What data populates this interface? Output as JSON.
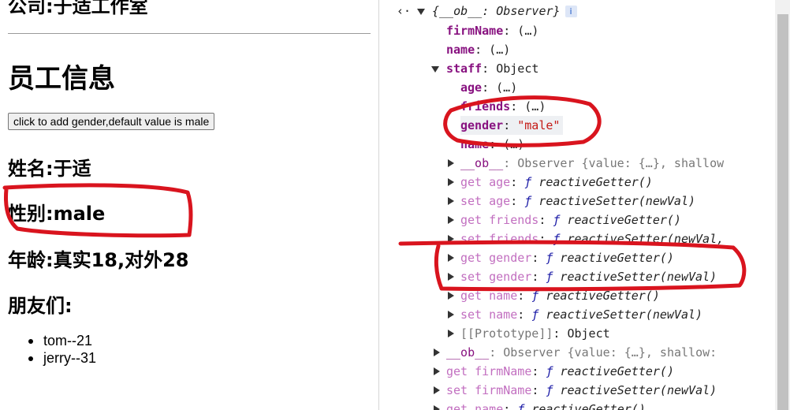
{
  "page": {
    "company": "公司:于适工作室",
    "title": "员工信息",
    "add_button": "click to add gender,default value is male",
    "name_line": "姓名:于适",
    "gender_line": "性别:male",
    "age_line": "年龄:真实18,对外28",
    "friends_heading": "朋友们:",
    "friends": [
      "tom--21",
      "jerry--31"
    ]
  },
  "devtools": {
    "back_arrow": "‹·",
    "root": {
      "text": "{__ob__: Observer}",
      "badge": "i"
    },
    "rows": [
      {
        "key": "firmName",
        "rest": ": (…)"
      },
      {
        "key": "name",
        "rest": ": (…)"
      },
      {
        "key": "staff",
        "rest": ": Object"
      },
      {
        "key": "age",
        "rest": ": (…)"
      },
      {
        "key": "friends",
        "rest": ": (…)"
      },
      {
        "key": "gender",
        "rest": ": ",
        "value": "\"male\""
      },
      {
        "key": "name",
        "rest": ": (…)"
      },
      {
        "key": "__ob__",
        "rest": ": Observer {value: {…}, shallow"
      },
      {
        "key": "get age",
        "rest": ": ",
        "fn": "ƒ",
        "call": " reactiveGetter()"
      },
      {
        "key": "set age",
        "rest": ": ",
        "fn": "ƒ",
        "call": " reactiveSetter(newVal)"
      },
      {
        "key": "get friends",
        "rest": ": ",
        "fn": "ƒ",
        "call": " reactiveGetter()"
      },
      {
        "key": "set friends",
        "rest": ": ",
        "fn": "ƒ",
        "call": " reactiveSetter(newVal,"
      },
      {
        "key": "get gender",
        "rest": ": ",
        "fn": "ƒ",
        "call": " reactiveGetter()"
      },
      {
        "key": "set gender",
        "rest": ": ",
        "fn": "ƒ",
        "call": " reactiveSetter(newVal)"
      },
      {
        "key": "get name",
        "rest": ": ",
        "fn": "ƒ",
        "call": " reactiveGetter()"
      },
      {
        "key": "set name",
        "rest": ": ",
        "fn": "ƒ",
        "call": " reactiveSetter(newVal)"
      },
      {
        "key": "[[Prototype]]",
        "rest": ": Object"
      },
      {
        "key": "__ob__",
        "rest": ": Observer {value: {…}, shallow:"
      },
      {
        "key": "get firmName",
        "rest": ": ",
        "fn": "ƒ",
        "call": " reactiveGetter()"
      },
      {
        "key": "set firmName",
        "rest": ": ",
        "fn": "ƒ",
        "call": " reactiveSetter(newVal)"
      },
      {
        "key": "get name",
        "rest": ": ",
        "fn": "ƒ",
        "call": " reactiveGetter()"
      }
    ]
  },
  "colors": {
    "annotation_red": "#d9141e",
    "key_purple": "#881280",
    "accessor_pink": "#c26fc0",
    "string_red": "#c41a16"
  }
}
